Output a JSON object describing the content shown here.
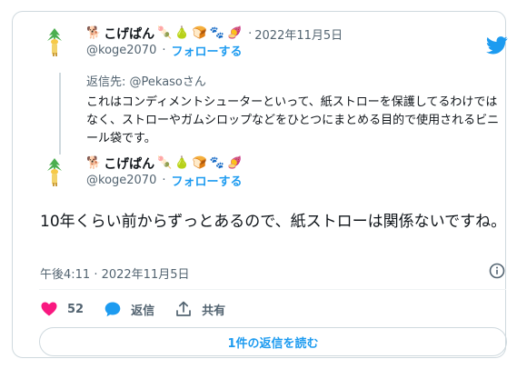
{
  "tweet1": {
    "display_name": "こげぱん",
    "emojis": [
      "🐕",
      "🍡",
      "🍐",
      "🍞",
      "🐾",
      "🍠"
    ],
    "date": "2022年11月5日",
    "separator": "·",
    "handle": "@koge2070",
    "handle_sep": "·",
    "follow_label": "フォローする",
    "reply_prefix": "返信先: ",
    "reply_mention": "@Pekasoさん",
    "text": "これはコンディメントシューターといって、紙ストローを保護してるわけではなく、ストローやガムシロップなどをひとつにまとめる目的で使用されるビニール袋です。"
  },
  "tweet2": {
    "display_name": "こげぱん",
    "emojis": [
      "🐕",
      "🍡",
      "🍐",
      "🍞",
      "🐾",
      "🍠"
    ],
    "handle": "@koge2070",
    "handle_sep": "·",
    "follow_label": "フォローする",
    "text": "10年くらい前からずっとあるので、紙ストローは関係ないですね。",
    "timestamp": "午後4:11 · 2022年11月5日"
  },
  "actions": {
    "like_count": "52",
    "reply_label": "返信",
    "share_label": "共有"
  },
  "read_replies_label": "1件の返信を読む",
  "icons": {
    "like": "heart-icon",
    "reply": "reply-bubble-icon",
    "share": "share-icon",
    "info": "info-icon",
    "logo": "twitter-bird-icon"
  },
  "colors": {
    "accent": "#1d9bf0",
    "like": "#f91880",
    "muted": "#536471",
    "text": "#0f1419",
    "border": "#cfd9de"
  }
}
